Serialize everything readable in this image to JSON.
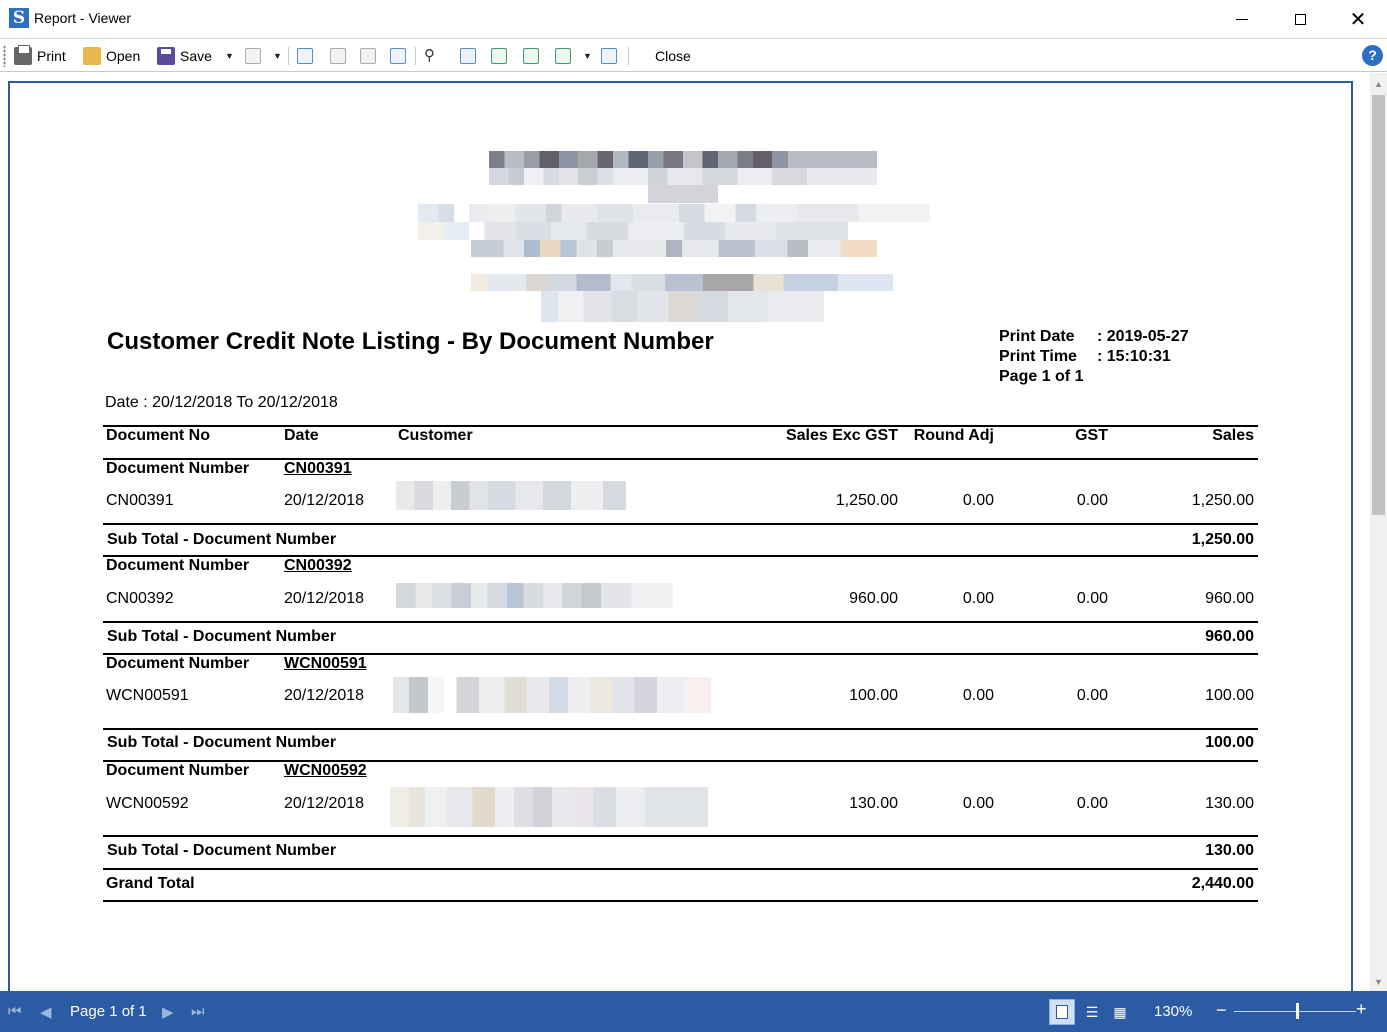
{
  "window": {
    "title": "Report - Viewer"
  },
  "toolbar": {
    "print_label": "Print",
    "open_label": "Open",
    "save_label": "Save",
    "close_label": "Close",
    "help_glyph": "?"
  },
  "report": {
    "title": "Customer Credit Note Listing - By Document Number",
    "print_date_label": "Print Date",
    "print_date_value": ": 2019-05-27",
    "print_time_label": "Print Time",
    "print_time_value": ": 15:10:31",
    "page_info": "Page 1 of 1",
    "date_range": "Date : 20/12/2018 To 20/12/2018",
    "columns": {
      "document_no": "Document No",
      "date": "Date",
      "customer": "Customer",
      "sales_exc_gst": "Sales Exc GST",
      "round_adj": "Round Adj",
      "gst": "GST",
      "sales": "Sales"
    },
    "group_label": "Document Number",
    "subtotal_label": "Sub Total - Document Number",
    "groups": [
      {
        "doc": "CN00391",
        "date": "20/12/2018",
        "sales_exc_gst": "1,250.00",
        "round_adj": "0.00",
        "gst": "0.00",
        "sales": "1,250.00",
        "subtotal": "1,250.00"
      },
      {
        "doc": "CN00392",
        "date": "20/12/2018",
        "sales_exc_gst": "960.00",
        "round_adj": "0.00",
        "gst": "0.00",
        "sales": "960.00",
        "subtotal": "960.00"
      },
      {
        "doc": "WCN00591",
        "date": "20/12/2018",
        "sales_exc_gst": "100.00",
        "round_adj": "0.00",
        "gst": "0.00",
        "sales": "100.00",
        "subtotal": "100.00"
      },
      {
        "doc": "WCN00592",
        "date": "20/12/2018",
        "sales_exc_gst": "130.00",
        "round_adj": "0.00",
        "gst": "0.00",
        "sales": "130.00",
        "subtotal": "130.00"
      }
    ],
    "grand_total_label": "Grand Total",
    "grand_total_value": "2,440.00"
  },
  "statusbar": {
    "page_label": "Page 1 of 1",
    "zoom": "130%"
  },
  "colors": {
    "accent": "#2a5ba3",
    "help": "#2b6fc4"
  },
  "icons": [
    "app-logo-icon",
    "print-icon",
    "open-folder-icon",
    "save-disk-icon",
    "binoculars-icon",
    "help-icon",
    "first-page-icon",
    "prev-page-icon",
    "next-page-icon",
    "last-page-icon"
  ]
}
